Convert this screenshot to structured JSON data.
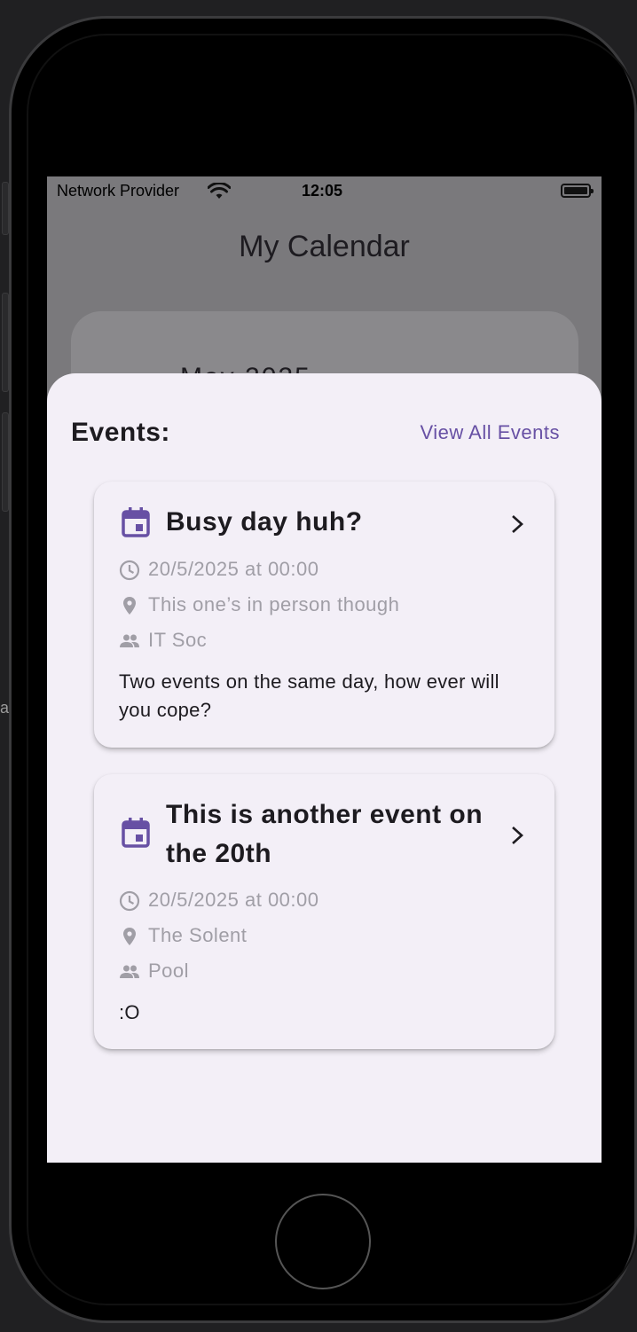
{
  "status_bar": {
    "carrier": "Network Provider",
    "time": "12:05"
  },
  "app": {
    "title": "My Calendar",
    "background_month": "May 2025"
  },
  "sheet": {
    "events_label": "Events:",
    "view_all_label": "View All Events"
  },
  "events": [
    {
      "title": "Busy day huh?",
      "datetime": "20/5/2025 at 00:00",
      "location": "This one’s in person though",
      "society": "IT Soc",
      "description": "Two events on the same day, how ever will you cope?"
    },
    {
      "title": "This is another event on the 20th",
      "datetime": "20/5/2025 at 00:00",
      "location": "The Solent",
      "society": "Pool",
      "description": ":O"
    }
  ],
  "colors": {
    "accent": "#6750a4",
    "sheet_background": "#f3eff7",
    "muted_text": "#a09ea6"
  },
  "icons": {
    "event": "calendar-icon",
    "open": "chevron-right-icon",
    "time": "clock-icon",
    "location": "location-pin-icon",
    "society": "people-icon",
    "signal": "wifi-icon",
    "battery": "battery-icon"
  }
}
